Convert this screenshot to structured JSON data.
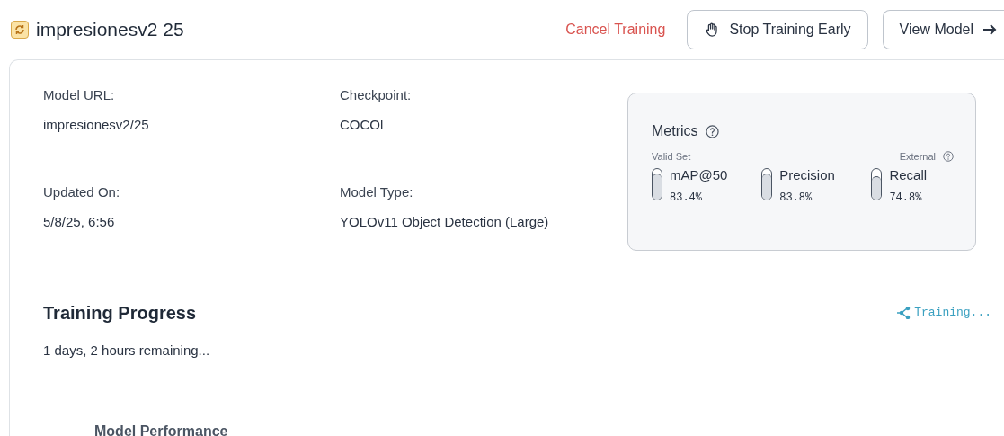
{
  "header": {
    "title": "impresionesv2 25",
    "actions": [
      {
        "kind": "link",
        "label": "Cancel Training"
      },
      {
        "kind": "hand",
        "label": "Stop Training Early"
      },
      {
        "kind": "arrow",
        "label": "View Model"
      }
    ]
  },
  "fields": [
    {
      "label": "Model URL:",
      "value": "impresionesv2/25"
    },
    {
      "label": "Checkpoint:",
      "value": "COCOl"
    },
    {
      "label": "Updated On:",
      "value": "5/8/25, 6:56"
    },
    {
      "label": "Model Type:",
      "value": "YOLOv11 Object Detection (Large)"
    }
  ],
  "metrics": {
    "title": "Metrics",
    "left_caption": "Valid Set",
    "right_caption": "External",
    "items": [
      {
        "name": "mAP@50",
        "reading": "83.4%",
        "level": 0.834
      },
      {
        "name": "Precision",
        "reading": "83.8%",
        "level": 0.838
      },
      {
        "name": "Recall",
        "reading": "74.8%",
        "level": 0.748
      }
    ]
  },
  "progress": {
    "title": "Training Progress",
    "status": "Training...",
    "remaining": "1 days, 2 hours remaining..."
  },
  "section_title": "Model Performance"
}
